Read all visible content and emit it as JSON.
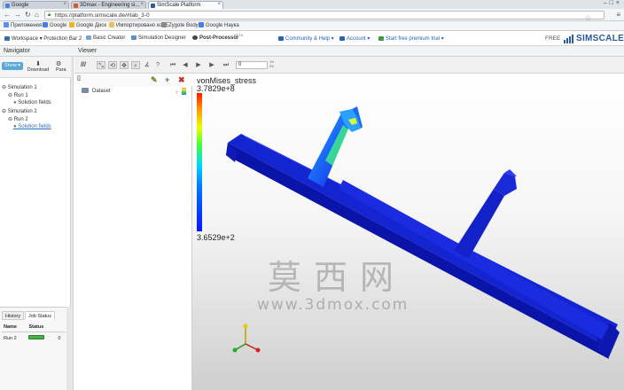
{
  "browser": {
    "tabs": [
      {
        "label": "Google",
        "color": "#4a7fe0"
      },
      {
        "label": "3Dmax - Engineering si...",
        "color": "#d35a2b"
      },
      {
        "label": "SimScale Platform",
        "color": "#2a5d9c"
      }
    ],
    "url": "https://platform.simscale.de/#tab_3-0",
    "bookmarks": [
      {
        "label": "Приложения",
        "color": "#5a8ee8"
      },
      {
        "label": "Google",
        "color": "#4a7fe0"
      },
      {
        "label": "Google Диск",
        "color": "#f0b429"
      },
      {
        "label": "Импортировано из IE",
        "color": "#e8c15a"
      },
      {
        "label": "Zygote Body",
        "color": "#888"
      },
      {
        "label": "Google Наука",
        "color": "#4a7fe0"
      }
    ]
  },
  "app_header": {
    "workspace": "Workspace ▾ Protection Bar 2",
    "basic_creator": "Basic Creator",
    "simulation_designer": "Simulation Designer",
    "post_processor": "Post-Processor",
    "post_processor_badge": "BETA",
    "community": "Community & Help ▾",
    "account": "Account ▾",
    "trial": "Start free premium trial ▾",
    "plan": "FREE",
    "logo": "SIMSCALE"
  },
  "navigator": {
    "title": "Navigator",
    "show_button": "Show ▾",
    "download_button": "Download",
    "params_button": "Para",
    "tree": [
      "Simulation 1",
      "Run 1",
      "Solution fields",
      "Simulation 2",
      "Run 2",
      "Solution fields"
    ]
  },
  "job_panel": {
    "tabs": [
      "History",
      "Job Status"
    ],
    "columns": [
      "Name",
      "Status"
    ],
    "rows": [
      {
        "name": "Run 2",
        "status": "Finished",
        "extra": "0"
      }
    ]
  },
  "viewer": {
    "title": "Viewer",
    "frame": "0",
    "speed_label": "1X\n2X"
  },
  "dataset_panel": {
    "item": "Dataset"
  },
  "legend": {
    "title": "vonMises_stress",
    "max": "3.7829e+8",
    "min": "3.6529e+2"
  },
  "watermark": {
    "cn": "莫西网",
    "url": "www.3dmox.com"
  }
}
